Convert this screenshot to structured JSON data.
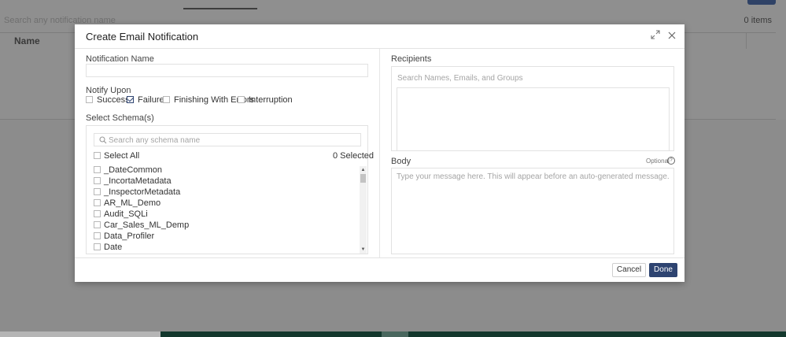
{
  "background": {
    "search_placeholder": "Search any notification name",
    "items_count": "0 items",
    "column_name": "Name"
  },
  "modal": {
    "title": "Create Email Notification",
    "expand_icon": "expand-icon",
    "close_icon": "close-icon",
    "notification_name": {
      "label": "Notification Name",
      "value": "",
      "placeholder": ""
    },
    "notify_upon": {
      "label": "Notify Upon",
      "options": [
        {
          "label": "Success",
          "checked": false
        },
        {
          "label": "Failure",
          "checked": true
        },
        {
          "label": "Finishing With Errors",
          "checked": false
        },
        {
          "label": "Interruption",
          "checked": false
        }
      ]
    },
    "schemas": {
      "label": "Select Schema(s)",
      "search_placeholder": "Search any schema name",
      "select_all": "Select All",
      "selected_count": "0 Selected",
      "items": [
        "_DateCommon",
        "_IncortaMetadata",
        "_InspectorMetadata",
        "AR_ML_Demo",
        "Audit_SQLi",
        "Car_Sales_ML_Demp",
        "Data_Profiler",
        "Date"
      ]
    },
    "recipients": {
      "label": "Recipients",
      "placeholder": "Search Names, Emails, and Groups"
    },
    "body": {
      "label": "Body",
      "optional": "Optional",
      "placeholder": "Type your message here. This will appear before an auto-generated message."
    },
    "buttons": {
      "cancel": "Cancel",
      "done": "Done"
    },
    "colors": {
      "primary": "#2e4471"
    }
  }
}
